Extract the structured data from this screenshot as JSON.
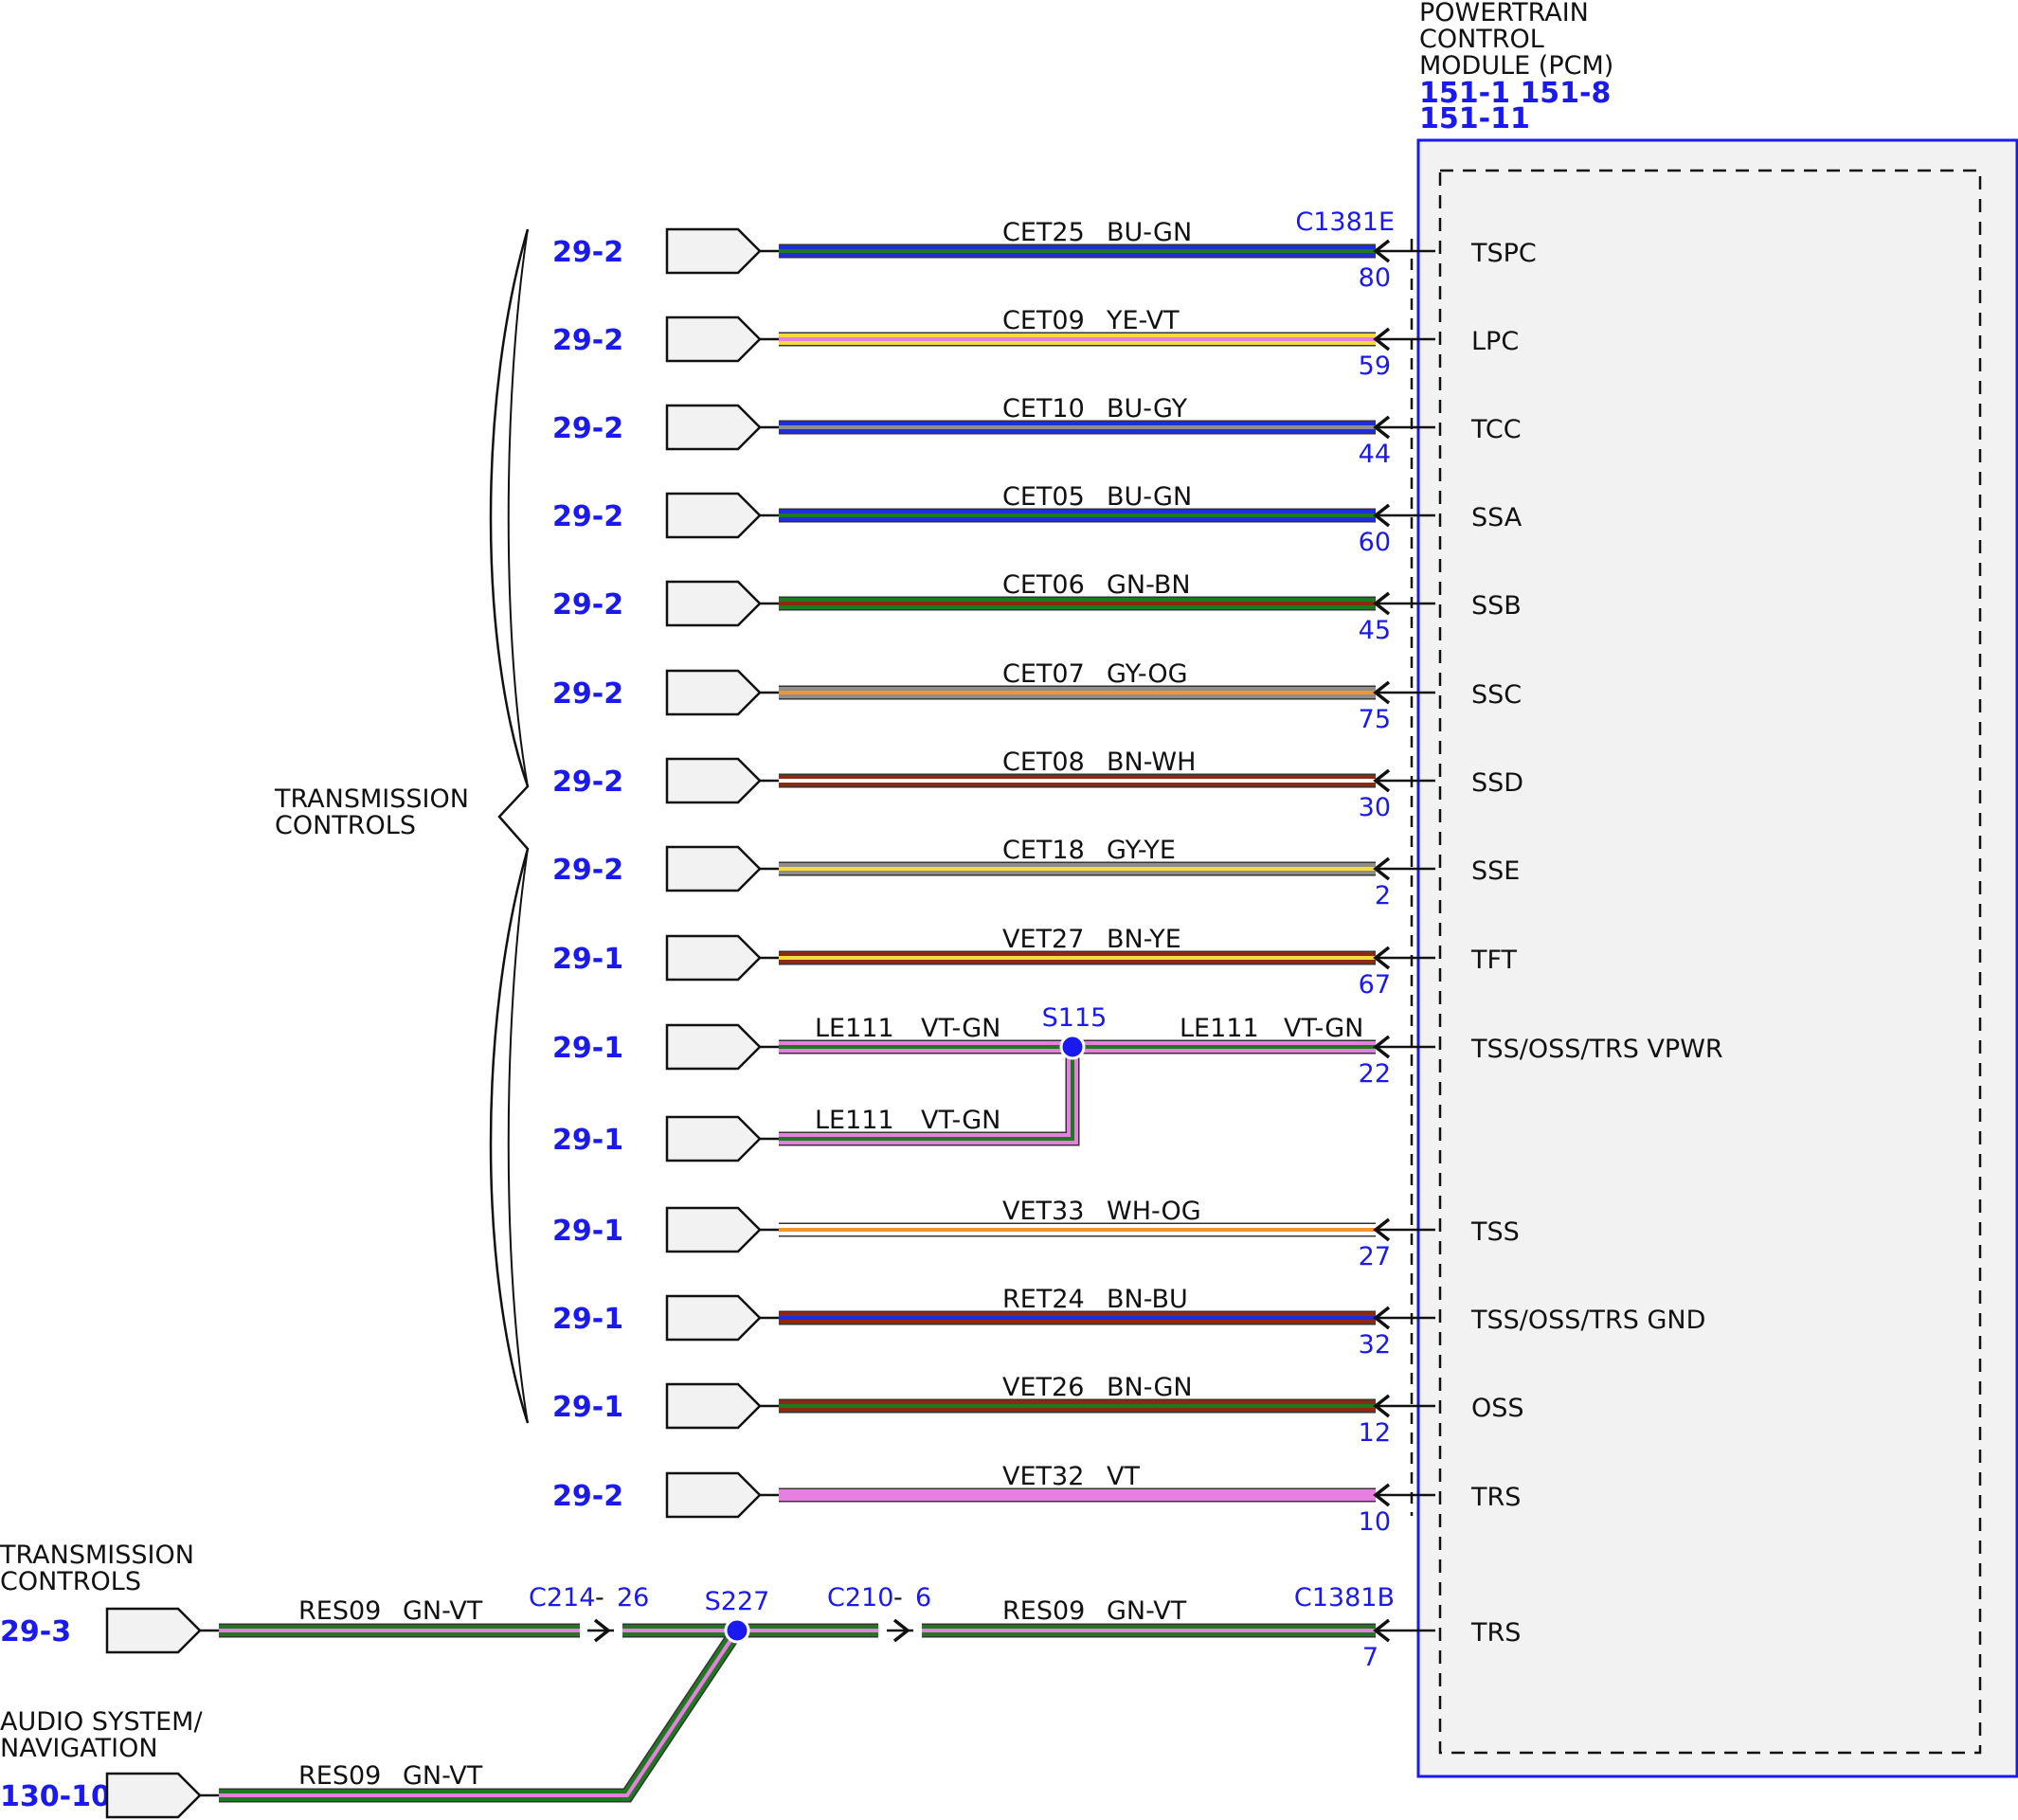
{
  "colors": {
    "ref_blue": "#1a1aee",
    "module_border": "#1a1aee",
    "module_fill": "#f2f2f2",
    "BU": "#1f2fd6",
    "GN": "#1e7a1e",
    "YE": "#f5dc3c",
    "VT": "#e77fe0",
    "GY": "#8e8e8e",
    "OG": "#f0962d",
    "BN": "#8c2a14",
    "WH": "#ffffff"
  },
  "module": {
    "title_lines": [
      "POWERTRAIN",
      "CONTROL",
      "MODULE (PCM)"
    ],
    "ref_lines": [
      "151-1 151-8",
      "151-11"
    ],
    "connector_top": "C1381E",
    "connector_bottom": "C1381B"
  },
  "group": {
    "label_lines": [
      "TRANSMISSION",
      "CONTROLS"
    ]
  },
  "circuits": [
    {
      "ref": "29-2",
      "circuit": "CET25",
      "color": "BU-GN",
      "pin": "80",
      "signal": "TSPC"
    },
    {
      "ref": "29-2",
      "circuit": "CET09",
      "color": "YE-VT",
      "pin": "59",
      "signal": "LPC"
    },
    {
      "ref": "29-2",
      "circuit": "CET10",
      "color": "BU-GY",
      "pin": "44",
      "signal": "TCC"
    },
    {
      "ref": "29-2",
      "circuit": "CET05",
      "color": "BU-GN",
      "pin": "60",
      "signal": "SSA"
    },
    {
      "ref": "29-2",
      "circuit": "CET06",
      "color": "GN-BN",
      "pin": "45",
      "signal": "SSB"
    },
    {
      "ref": "29-2",
      "circuit": "CET07",
      "color": "GY-OG",
      "pin": "75",
      "signal": "SSC"
    },
    {
      "ref": "29-2",
      "circuit": "CET08",
      "color": "BN-WH",
      "pin": "30",
      "signal": "SSD"
    },
    {
      "ref": "29-2",
      "circuit": "CET18",
      "color": "GY-YE",
      "pin": "2",
      "signal": "SSE"
    },
    {
      "ref": "29-1",
      "circuit": "VET27",
      "color": "BN-YE",
      "pin": "67",
      "signal": "TFT"
    }
  ],
  "splice_s115": {
    "splice": "S115",
    "ref_top": "29-1",
    "ref_bottom": "29-1",
    "circuit": "LE111",
    "color": "VT-GN",
    "pin": "22",
    "signal": "TSS/OSS/TRS VPWR"
  },
  "circuits_lower": [
    {
      "ref": "29-1",
      "circuit": "VET33",
      "color": "WH-OG",
      "pin": "27",
      "signal": "TSS"
    },
    {
      "ref": "29-1",
      "circuit": "RET24",
      "color": "BN-BU",
      "pin": "32",
      "signal": "TSS/OSS/TRS GND"
    },
    {
      "ref": "29-1",
      "circuit": "VET26",
      "color": "BN-GN",
      "pin": "12",
      "signal": "OSS"
    },
    {
      "ref": "29-2",
      "circuit": "VET32",
      "color": "VT",
      "pin": "10",
      "signal": "TRS"
    }
  ],
  "bottom": {
    "source1_lines": [
      "TRANSMISSION",
      "CONTROLS"
    ],
    "source1_ref": "29-3",
    "source2_lines": [
      "AUDIO SYSTEM/",
      "NAVIGATION"
    ],
    "source2_ref": "130-10",
    "circuit": "RES09",
    "color": "GN-VT",
    "conn1": "C214",
    "conn1_pin": "26",
    "splice": "S227",
    "conn2": "C210",
    "conn2_pin": "6",
    "dash": "-",
    "pin": "7",
    "signal": "TRS"
  }
}
